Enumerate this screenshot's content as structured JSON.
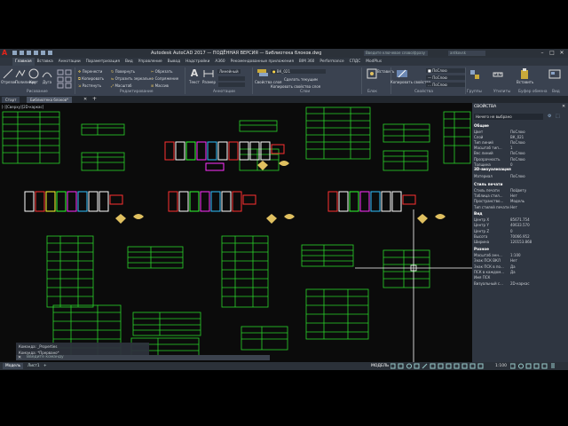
{
  "app": {
    "logo_glyph": "A",
    "title": "Autodesk AutoCAD 2017 — ПОДЁННАЯ ВЕРСИЯ — Библиотека блоков.dwg",
    "search_placeholder": "Введите ключевое слово/фразу",
    "user_label": "ardkovsk"
  },
  "ribbon_tabs": [
    "Главная",
    "Вставка",
    "Аннотации",
    "Параметризация",
    "Вид",
    "Управление",
    "Вывод",
    "Надстройки",
    "A360",
    "Рекомендованные приложения",
    "BIM 360",
    "Performance",
    "СПДС",
    "ModPlus"
  ],
  "active_tab_index": 0,
  "ribbon": {
    "draw_buttons": [
      "Отрезок",
      "Полилиния",
      "Круг",
      "Дуга"
    ],
    "modify_buttons": [
      "Перенести",
      "Повернуть",
      "Обрезать",
      "Копировать",
      "Отразить зеркально",
      "Сопряжение",
      "Растянуть",
      "Масштаб",
      "Массив"
    ],
    "annotation_buttons": [
      "Текст",
      "Размер"
    ],
    "text_style": "Линейный",
    "layer_name": "ВК_021",
    "layer_actions": [
      "Свойства слоя",
      "Сделать текущим",
      "Копировать свойства слоя"
    ],
    "block_buttons": [
      "Вставить"
    ],
    "properties": {
      "match_label": "Копировать свойства",
      "color": "ПоСлою",
      "linetype": "ПоСлою",
      "lineweight": "ПоСлою"
    },
    "groups_label": "Группы",
    "utilities_label": "Утилиты",
    "clipboard": [
      "Вставить",
      "Буфер обмена"
    ],
    "view_label": "Вид",
    "panel_titles": [
      "Рисование",
      "Редактирование",
      "Аннотации",
      "Слои",
      "Блок",
      "Свойства",
      "Группы",
      "Утилиты",
      "Буфер обмена",
      "Вид"
    ]
  },
  "doc_tabs": [
    "Старт",
    "Библиотека блоков*"
  ],
  "viewport_label": "[-][Сверху][2D-каркас]",
  "properties_panel": {
    "title": "СВОЙСТВА",
    "selection": "Ничего не выбрано",
    "sections": {
      "general": "Общие",
      "viz3d": "3D-визуализация",
      "plotstyle": "Стиль печати",
      "view": "Вид",
      "misc": "Разное"
    },
    "general_rows": [
      [
        "Цвет",
        "ПоСлою"
      ],
      [
        "Слой",
        "ВК_021"
      ],
      [
        "Тип линий",
        "ПоСлою"
      ],
      [
        "Масштаб тип...",
        "1"
      ],
      [
        "Вес линий",
        "ПоСлою"
      ],
      [
        "Прозрачность",
        "ПоСлою"
      ],
      [
        "Толщина",
        "0"
      ]
    ],
    "viz3d_rows": [
      [
        "Материал",
        "ПоСлою"
      ]
    ],
    "plotstyle_rows": [
      [
        "Стиль печати",
        "ПоЦвету"
      ],
      [
        "Таблица стил...",
        "Нет"
      ],
      [
        "Пространство...",
        "Модель"
      ],
      [
        "Тип стилей печати",
        "Нет"
      ]
    ],
    "view_rows": [
      [
        "Центр X",
        "85671.754"
      ],
      [
        "Центр Y",
        "40633.570"
      ],
      [
        "Центр Z",
        "0"
      ],
      [
        "Высота",
        "70066.952"
      ],
      [
        "Ширина",
        "120153.868"
      ]
    ],
    "misc_rows": [
      [
        "Масштаб анн...",
        "1:100"
      ],
      [
        "Знак ПСК ВКЛ",
        "Нет"
      ],
      [
        "Знак ПСК в по...",
        "Да"
      ],
      [
        "ПСК в каждом...",
        "Да"
      ],
      [
        "Имя ПСК",
        ""
      ],
      [
        "Визуальный с...",
        "2D-каркас"
      ]
    ]
  },
  "command_history": [
    "Команда: _Properties",
    "Команда: *Прервано*"
  ],
  "command_placeholder": "Введите команду",
  "layout_tabs": [
    "Модель",
    "Лист1"
  ],
  "active_layout": 0,
  "status": {
    "model_label": "МОДЕЛЬ",
    "scale": "1:100"
  },
  "colors": {
    "accent_red": "#e2231a",
    "table_green": "#2ad42a",
    "ribbon_bg": "#3a4250",
    "panel_bg": "#2f3641"
  }
}
